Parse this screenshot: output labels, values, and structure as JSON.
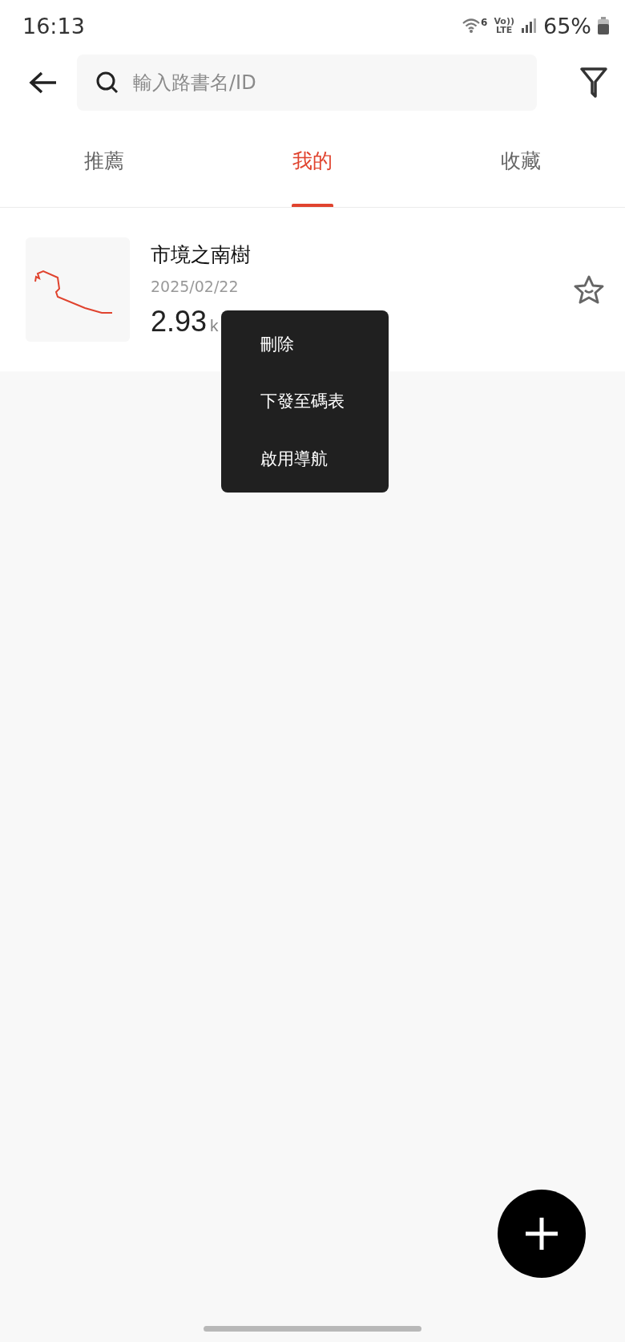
{
  "status_bar": {
    "time": "16:13",
    "wifi_label": "6",
    "network_label": "Vo))\nLTE",
    "battery": "65%"
  },
  "search": {
    "placeholder": "輸入路書名/ID"
  },
  "tabs": [
    {
      "label": "推薦",
      "selected": false
    },
    {
      "label": "我的",
      "selected": true
    },
    {
      "label": "收藏",
      "selected": false
    }
  ],
  "routes": [
    {
      "name": "市境之南樹",
      "date": "2025/02/22",
      "distance": "2.93",
      "unit": "k",
      "favorited": false
    }
  ],
  "context_menu": {
    "items": [
      "刪除",
      "下發至碼表",
      "啟用導航"
    ]
  }
}
